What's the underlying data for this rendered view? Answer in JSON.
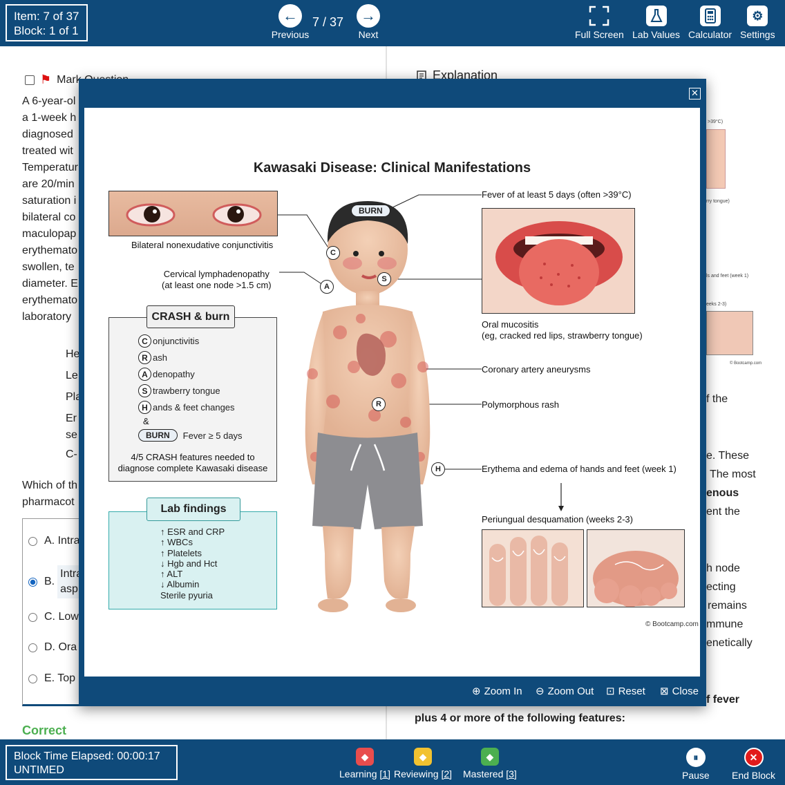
{
  "topbar": {
    "item_label": "Item: 7 of 37",
    "block_label": "Block: 1 of 1",
    "previous": "Previous",
    "next": "Next",
    "pager": "7 / 37",
    "tools": [
      "Full Screen",
      "Lab Values",
      "Calculator",
      "Settings"
    ]
  },
  "question": {
    "mark_label": "Mark Question",
    "lines": [
      "A 6-year-ol",
      "a 1-week h",
      "diagnosed",
      "treated wit",
      "Temperatur",
      "are 20/min",
      "saturation i",
      "bilateral co",
      "maculopap",
      "erythemato",
      "swollen, te",
      "diameter. E",
      "erythemato",
      "laboratory"
    ],
    "lab_labels": [
      "He",
      "Le",
      "Pla",
      "Er",
      "se",
      "C-"
    ],
    "stem_lines": [
      "Which of th",
      "pharmacot"
    ],
    "answers": [
      {
        "label": "A. Intra",
        "selected": false
      },
      {
        "label": "B.",
        "sub1": "Intra",
        "sub2": "asp",
        "selected": true
      },
      {
        "label": "C. Low",
        "selected": false
      },
      {
        "label": "D. Ora",
        "selected": false
      },
      {
        "label": "E. Top",
        "selected": false
      }
    ],
    "correct_label": "Correct"
  },
  "explanation": {
    "heading": "Explanation",
    "fragments": [
      "f the",
      "e. These",
      "The most",
      "enous",
      "ent the",
      "h node",
      "ecting",
      "remains",
      "mmune",
      "enetically",
      "f fever"
    ],
    "bottom_line": "plus 4 or more of the following features:",
    "tiny_labels": [
      ">39°C)",
      "rry tongue)",
      "ls and feet (week 1)",
      "eeks 2-3)",
      "© Bootcamp.com"
    ]
  },
  "modal": {
    "tools": [
      "Zoom In",
      "Zoom Out",
      "Reset",
      "Close"
    ],
    "figure": {
      "title": "Kawasaki Disease: Clinical Manifestations",
      "conjunctivitis": "Bilateral nonexudative conjunctivitis",
      "lymph_line1": "Cervical lymphadenopathy",
      "lymph_line2": "(at least one node >1.5 cm)",
      "fever": "Fever of at least 5 days (often >39°C)",
      "oral_line1": "Oral mucositis",
      "oral_line2": "(eg, cracked red lips, strawberry tongue)",
      "coronary": "Coronary artery aneurysms",
      "rash": "Polymorphous rash",
      "hands": "Erythema and edema of hands and feet (week 1)",
      "desquamation": "Periungual desquamation (weeks 2-3)",
      "burn_tag": "BURN",
      "crash_title": "CRASH & burn",
      "crash_rows": [
        {
          "letter": "C",
          "text": "onjunctivitis"
        },
        {
          "letter": "R",
          "text": "ash"
        },
        {
          "letter": "A",
          "text": "denopathy"
        },
        {
          "letter": "S",
          "text": "trawberry tongue"
        },
        {
          "letter": "H",
          "text": "ands & feet changes"
        }
      ],
      "amp": "&",
      "burn_label": "BURN",
      "burn_text": "Fever ≥ 5 days",
      "crash_note1": "4/5 CRASH features needed to",
      "crash_note2": "diagnose complete Kawasaki disease",
      "lab_title": "Lab findings",
      "lab_lines": [
        "↑ ESR and CRP",
        "↑ WBCs",
        "↑ Platelets",
        "↓ Hgb and Hct",
        "↑ ALT",
        "↓ Albumin",
        "Sterile pyuria"
      ],
      "markers": [
        "C",
        "A",
        "S",
        "R",
        "H"
      ],
      "copyright": "© Bootcamp.com"
    }
  },
  "bottombar": {
    "timer_label": "Block Time Elapsed: 00:00:17",
    "timer_mode": "UNTIMED",
    "learning": "Learning",
    "learning_count": "[1]",
    "reviewing": "Reviewing",
    "reviewing_count": "[2]",
    "mastered": "Mastered",
    "mastered_count": "[3]",
    "pause": "Pause",
    "end": "End Block"
  },
  "colors": {
    "brand": "#0f4a7a",
    "correct": "#4caf50",
    "learning": "#e84d4d",
    "reviewing": "#f2c230",
    "mastered": "#4caf50",
    "end": "#e21b1b"
  }
}
